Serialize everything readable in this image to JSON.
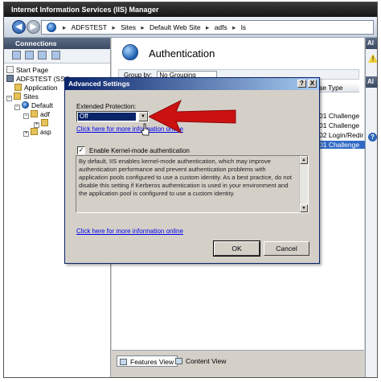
{
  "window": {
    "title": "Internet Information Services (IIS) Manager"
  },
  "address": {
    "crumbs": [
      "ADFSTEST",
      "Sites",
      "Default Web Site",
      "adfs",
      "ls"
    ],
    "separator": "▸"
  },
  "connections": {
    "title": "Connections",
    "tree": [
      "Start Page",
      "ADFSTEST (SSC",
      "Application",
      "Sites",
      "Default",
      "adf",
      "asp"
    ]
  },
  "main": {
    "title": "Authentication",
    "group_label": "Group by:",
    "group_value": "No Grouping",
    "column_type": "se Type",
    "rows": [
      "01 Challenge",
      "01 Challenge",
      "02 Login/Redir",
      "01 Challenge"
    ],
    "tabs": [
      "Features View",
      "Content View"
    ]
  },
  "actions": {
    "title": "Al",
    "subtitle": "Al"
  },
  "dialog": {
    "title": "Advanced Settings",
    "help_symbol": "?",
    "close_symbol": "X",
    "ep_label": "Extended Protection:",
    "ep_value": "Off",
    "link1": "Click here for more information online",
    "kernel_label": "Enable Kernel-mode authentication",
    "kernel_checked": "✓",
    "description": "By default, IIS enables kernel-mode authentication, which may improve authentication performance and prevent authentication problems with application pools configured to use a custom identity. As a best practice, do not disable this setting if Kerberos authentication is used in your environment and the application pool is configured to use a custom identity.",
    "link2": "Click here for more information online",
    "ok_label": "OK",
    "cancel_label": "Cancel"
  },
  "colors": {
    "arrow": "#cc1111",
    "title_bar": "#0a246a",
    "selection": "#316ac5"
  },
  "icons": [
    "back-arrow-icon",
    "forward-arrow-icon",
    "globe-icon",
    "warning-icon",
    "help-icon",
    "red-annotation-arrow",
    "mouse-cursor-icon"
  ]
}
